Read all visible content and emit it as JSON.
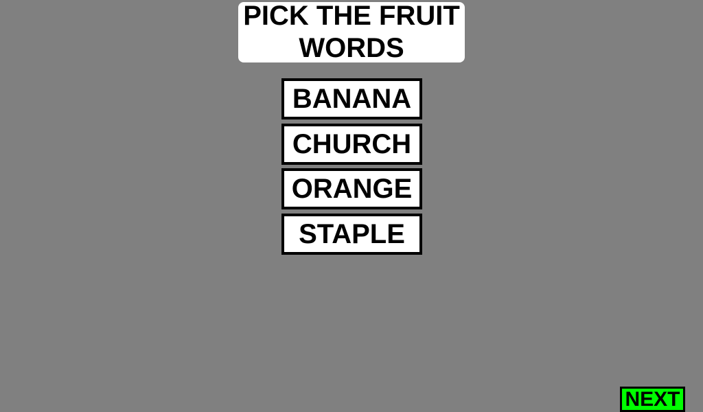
{
  "prompt": {
    "title": "PICK THE FRUIT WORDS"
  },
  "choices": [
    {
      "label": "BANANA"
    },
    {
      "label": "CHURCH"
    },
    {
      "label": "ORANGE"
    },
    {
      "label": "STAPLE"
    }
  ],
  "controls": {
    "next_label": "NEXT"
  },
  "colors": {
    "background": "#808080",
    "card": "#ffffff",
    "border": "#000000",
    "next_button": "#00ff00"
  }
}
